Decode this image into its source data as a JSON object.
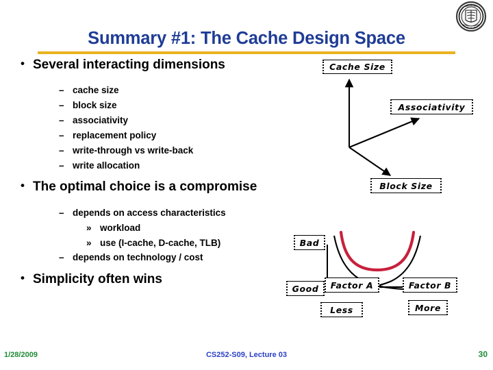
{
  "slide": {
    "title": "Summary #1: The Cache Design Space",
    "title_color": "#1F3C96",
    "rule_color": "#E8B320",
    "seal_name": "uc-berkeley-seal"
  },
  "outline": {
    "bullet_l1": "•",
    "bullet_l2": "–",
    "bullet_l3": "»",
    "item1": "Several interacting dimensions",
    "item1_subs": [
      "cache size",
      "block size",
      "associativity",
      "replacement policy",
      "write-through vs write-back",
      "write allocation"
    ],
    "item2": "The optimal choice is a compromise",
    "item2_sub1": "depends on access characteristics",
    "item2_sub1_subs": [
      "workload",
      "use (I-cache, D-cache, TLB)"
    ],
    "item2_sub2": "depends on technology / cost",
    "item3": "Simplicity often wins"
  },
  "axis_diagram": {
    "cache_size": "Cache Size",
    "associativity": "Associativity",
    "block_size": "Block Size"
  },
  "chart_data": {
    "type": "line",
    "title": "",
    "xlabel": "",
    "ylabel": "",
    "axis_labels": {
      "y_top": "Bad",
      "y_bottom": "Good",
      "x_left": "Less",
      "x_right": "More"
    },
    "legend": [
      "Factor A",
      "Factor B"
    ],
    "legend_position": "inline-on-curves",
    "grid": false,
    "series": [
      {
        "name": "Factor A",
        "color": "#000000",
        "description": "decreasing curve from bad at less to good at more",
        "x": [
          0,
          0.15,
          0.3,
          0.45,
          0.6,
          0.75,
          0.9,
          1.0
        ],
        "y": [
          1.0,
          0.72,
          0.5,
          0.34,
          0.22,
          0.14,
          0.09,
          0.07
        ]
      },
      {
        "name": "Factor B",
        "color": "#000000",
        "description": "increasing curve from good at less to bad at more",
        "x": [
          0,
          0.15,
          0.3,
          0.45,
          0.6,
          0.75,
          0.9,
          1.0
        ],
        "y": [
          0.07,
          0.09,
          0.14,
          0.22,
          0.34,
          0.5,
          0.72,
          1.0
        ]
      },
      {
        "name": "Sum",
        "color": "#C8203C",
        "description": "U-shaped total cost curve with minimum in the middle",
        "x": [
          0,
          0.15,
          0.3,
          0.45,
          0.5,
          0.55,
          0.7,
          0.85,
          1.0
        ],
        "y": [
          1.0,
          0.62,
          0.33,
          0.16,
          0.13,
          0.16,
          0.33,
          0.62,
          1.0
        ]
      }
    ],
    "ylim": [
      0,
      1
    ],
    "xlim": [
      0,
      1
    ]
  },
  "footer": {
    "date": "1/28/2009",
    "center": "CS252-S09, Lecture 03",
    "page": "30",
    "date_color": "#1E8B35",
    "center_color": "#2A3FC4"
  }
}
